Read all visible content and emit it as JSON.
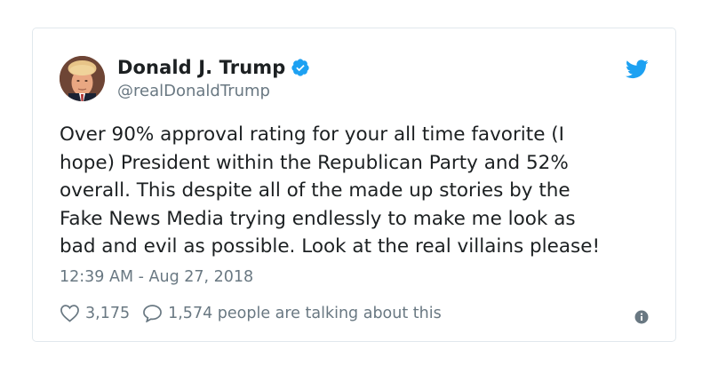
{
  "author": {
    "name": "Donald J. Trump",
    "handle": "@realDonaldTrump",
    "verified": true
  },
  "tweet": {
    "lines": [
      "Over 90% approval rating for your all time favorite (I",
      "hope) President within the Republican Party and 52%",
      "overall. This despite all of the made up stories by the",
      "Fake News Media trying endlessly to make me look as",
      "bad and evil as possible. Look at the real villains please!"
    ],
    "timestamp": "12:39 AM - Aug 27, 2018"
  },
  "actions": {
    "likes": "3,175",
    "conversation": "1,574 people are talking about this"
  },
  "icons": {
    "verified": "verified-badge-icon",
    "brand": "twitter-bird-icon",
    "like": "heart-icon",
    "reply": "speech-bubble-icon",
    "info": "info-icon"
  },
  "colors": {
    "brand_blue": "#1da1f2",
    "secondary_text": "#697882",
    "primary_text": "#1c2022",
    "border": "#e1e8ed"
  }
}
